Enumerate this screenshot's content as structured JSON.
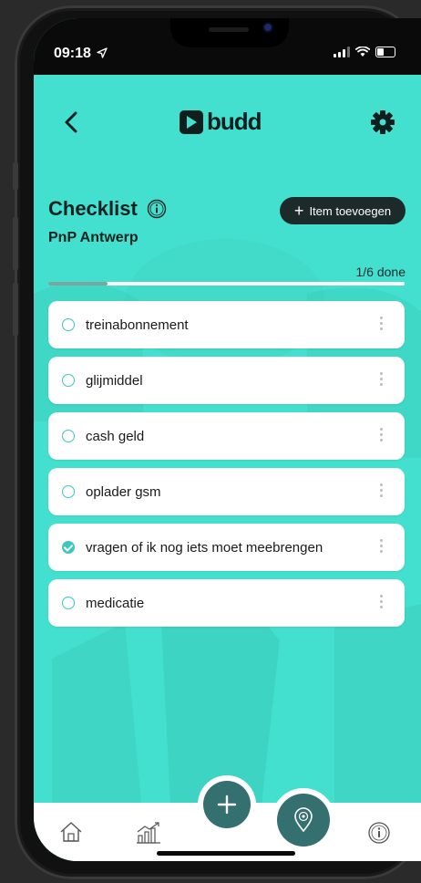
{
  "status_bar": {
    "time": "09:18"
  },
  "header": {
    "logo_text": "budd"
  },
  "checklist": {
    "title": "Checklist",
    "subtitle": "PnP Antwerp",
    "add_button_label": "Item toevoegen",
    "progress_text": "1/6 done",
    "progress_fraction": 0.167,
    "items": [
      {
        "label": "treinabonnement",
        "done": false
      },
      {
        "label": "glijmiddel",
        "done": false
      },
      {
        "label": "cash geld",
        "done": false
      },
      {
        "label": "oplader gsm",
        "done": false
      },
      {
        "label": "vragen of ik nog iets moet meebrengen",
        "done": true
      },
      {
        "label": "medicatie",
        "done": false
      }
    ]
  },
  "bottom_nav": {
    "items": [
      "home-icon",
      "stats-icon",
      "add-icon",
      "location-icon",
      "info-icon"
    ]
  },
  "colors": {
    "accent": "#44e0cf",
    "dark": "#1c2a29",
    "fab": "#34706f",
    "check": "#3ec7bd"
  }
}
